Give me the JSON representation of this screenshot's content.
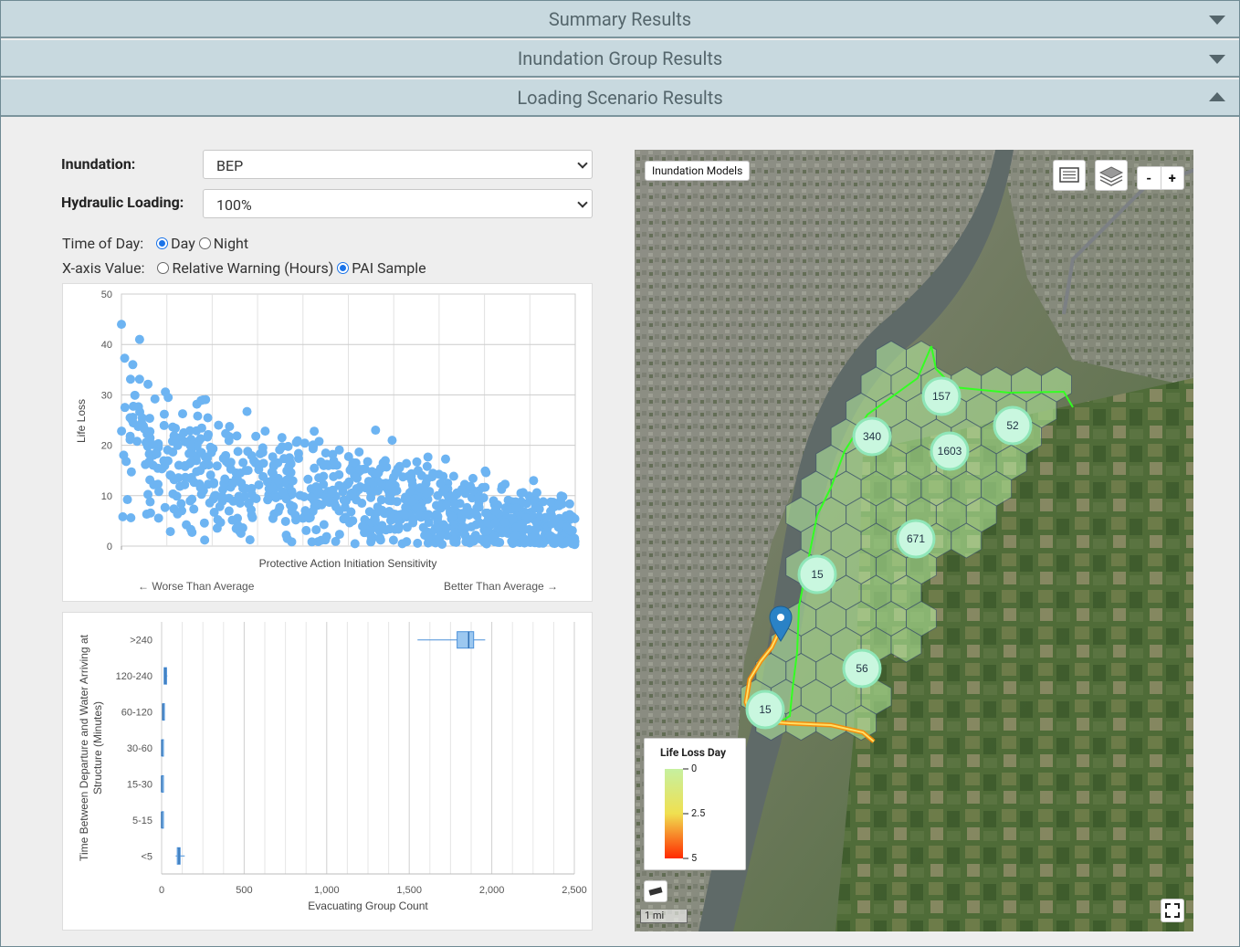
{
  "sections": [
    {
      "title": "Summary Results",
      "state": "collapsed"
    },
    {
      "title": "Inundation Group Results",
      "state": "collapsed"
    },
    {
      "title": "Loading Scenario Results",
      "state": "expanded"
    }
  ],
  "form": {
    "inundation_label": "Inundation:",
    "inundation_value": "BEP",
    "hydraulic_label": "Hydraulic Loading:",
    "hydraulic_value": "100%",
    "time_label": "Time of Day:",
    "time_day": "Day",
    "time_night": "Night",
    "time_selected": "Day",
    "xaxis_label": "X-axis Value:",
    "xaxis_opt1": "Relative Warning (Hours)",
    "xaxis_opt2": "PAI Sample",
    "xaxis_selected": "PAI Sample"
  },
  "scatter_chart": {
    "ylabel": "Life Loss",
    "xlabel": "Protective Action Initiation Sensitivity",
    "left_note": "← Worse Than Average",
    "right_note": "Better Than Average →",
    "yticks": [
      "0",
      "10",
      "20",
      "30",
      "40",
      "50"
    ]
  },
  "box_chart": {
    "ylabel_line1": "Time Between Departure and Water Arriving at",
    "ylabel_line2": "Structure (Minutes)",
    "xlabel": "Evacuating Group Count",
    "xticks": [
      "0",
      "500",
      "1,000",
      "1,500",
      "2,000",
      "2,500"
    ]
  },
  "map": {
    "inundation_models_btn": "Inundation Models",
    "zoom_out": "-",
    "zoom_in": "+",
    "legend_title": "Life Loss Day",
    "legend_ticks": [
      "0",
      "2.5",
      "5"
    ],
    "scale": "1 mi",
    "clusters": [
      "157",
      "52",
      "340",
      "1603",
      "671",
      "15",
      "56",
      "15"
    ]
  },
  "chart_data": [
    {
      "type": "scatter",
      "title": "",
      "xlabel": "Protective Action Initiation Sensitivity",
      "ylabel": "Life Loss",
      "ylim": [
        0,
        50
      ],
      "xlim": [
        0,
        1
      ],
      "grid": true,
      "trend": {
        "x": [
          0.0,
          0.05,
          0.1,
          0.2,
          0.3,
          0.4,
          0.5,
          0.6,
          0.7,
          0.8,
          0.9,
          1.0
        ],
        "y_mean": [
          24,
          19,
          17,
          15,
          13,
          11.5,
          10,
          8.5,
          7,
          5.5,
          3.5,
          1.5
        ]
      },
      "notable_points": [
        {
          "x": 0.0,
          "y": 44
        },
        {
          "x": 0.04,
          "y": 41
        },
        {
          "x": 0.025,
          "y": 36
        },
        {
          "x": 0.18,
          "y": 29
        },
        {
          "x": 0.56,
          "y": 23
        },
        {
          "x": 0.64,
          "y": 13
        },
        {
          "x": 0.82,
          "y": 9
        },
        {
          "x": 0.98,
          "y": 6
        }
      ]
    },
    {
      "type": "box",
      "title": "",
      "xlabel": "Evacuating Group Count",
      "ylabel": "Time Between Departure and Water Arriving at Structure (Minutes)",
      "categories": [
        ">240",
        "120-240",
        "60-120",
        "30-60",
        "15-30",
        "5-15",
        "<5"
      ],
      "xlim": [
        0,
        2500
      ],
      "series": [
        {
          "min": 1550,
          "q1": 1790,
          "median": 1860,
          "q3": 1890,
          "max": 1960
        },
        {
          "min": 15,
          "q1": 15,
          "median": 22,
          "q3": 30,
          "max": 35
        },
        {
          "min": 5,
          "q1": 6,
          "median": 8,
          "q3": 10,
          "max": 12
        },
        {
          "min": 0,
          "q1": 0,
          "median": 1,
          "q3": 1,
          "max": 2
        },
        {
          "min": 0,
          "q1": 0,
          "median": 0,
          "q3": 0,
          "max": 0
        },
        {
          "min": 0,
          "q1": 0,
          "median": 0,
          "q3": 0,
          "max": 0
        },
        {
          "min": 85,
          "q1": 95,
          "median": 105,
          "q3": 112,
          "max": 140
        }
      ]
    }
  ]
}
